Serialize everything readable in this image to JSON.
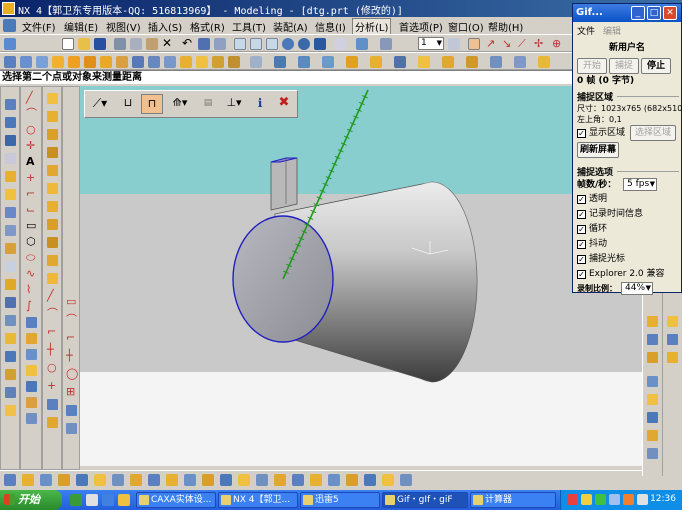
{
  "nx": {
    "title": "NX 4【郭卫东专用版本-QQ: 516813969】 - Modeling - [dtg.prt (修改的)]",
    "menu": [
      {
        "label": "文件(F)"
      },
      {
        "label": "编辑(E)"
      },
      {
        "label": "视图(V)"
      },
      {
        "label": "插入(S)"
      },
      {
        "label": "格式(R)"
      },
      {
        "label": "工具(T)"
      },
      {
        "label": "装配(A)"
      },
      {
        "label": "信息(I)"
      },
      {
        "label": "分析(L)"
      },
      {
        "label": "首选项(P)"
      },
      {
        "label": "窗口(O)"
      },
      {
        "label": "帮助(H)"
      }
    ],
    "active_menu": "分析(L)",
    "layer_select": "1",
    "prompt": "选择第二个点或对象来测量距离",
    "page_status": "1"
  },
  "gif": {
    "title": "Gif...",
    "menu": {
      "file": "文件",
      "edit": "编辑"
    },
    "new_user_label": "新用户名",
    "buttons": {
      "start": "开始",
      "capture": "捕捉",
      "stop": "停止",
      "select_area": "选择区域",
      "refresh": "刷新屏幕"
    },
    "frames": "0 帧 (0 字节)",
    "capture_area_title": "捕捉区域",
    "size": "尺寸：1023x765 (682x510)",
    "top_left": "左上角：0,1",
    "show_area": "显示区域",
    "capture_options_title": "捕捉选项",
    "fps_label": "帧数/秒：",
    "fps_value": "5 fps",
    "options": [
      {
        "label": "透明",
        "checked": true
      },
      {
        "label": "记录时间信息",
        "checked": true
      },
      {
        "label": "循环",
        "checked": true
      },
      {
        "label": "抖动",
        "checked": true
      },
      {
        "label": "捕捉光标",
        "checked": true
      },
      {
        "label": "Explorer 2.0 兼容",
        "checked": true
      }
    ],
    "scale_label": "录制比例：",
    "scale_value": "44%"
  },
  "taskbar": {
    "start": "开始",
    "tasks": [
      {
        "label": "CAXA实体设..."
      },
      {
        "label": "NX 4【郭卫..."
      },
      {
        "label": "迅雷5"
      },
      {
        "label": "Gif・gIf・giF"
      },
      {
        "label": "计算器"
      }
    ],
    "clock": "12:36"
  },
  "colors": {
    "title_bar": "#0a246a",
    "viewport_sky": "#88cece",
    "viewport_floor": "#c9c9c9",
    "viewport_ground": "#f4f4f4",
    "measure_line": "#1f9a1f",
    "edge_highlight": "#2020c0",
    "snap_pressed": "#f0c090"
  }
}
